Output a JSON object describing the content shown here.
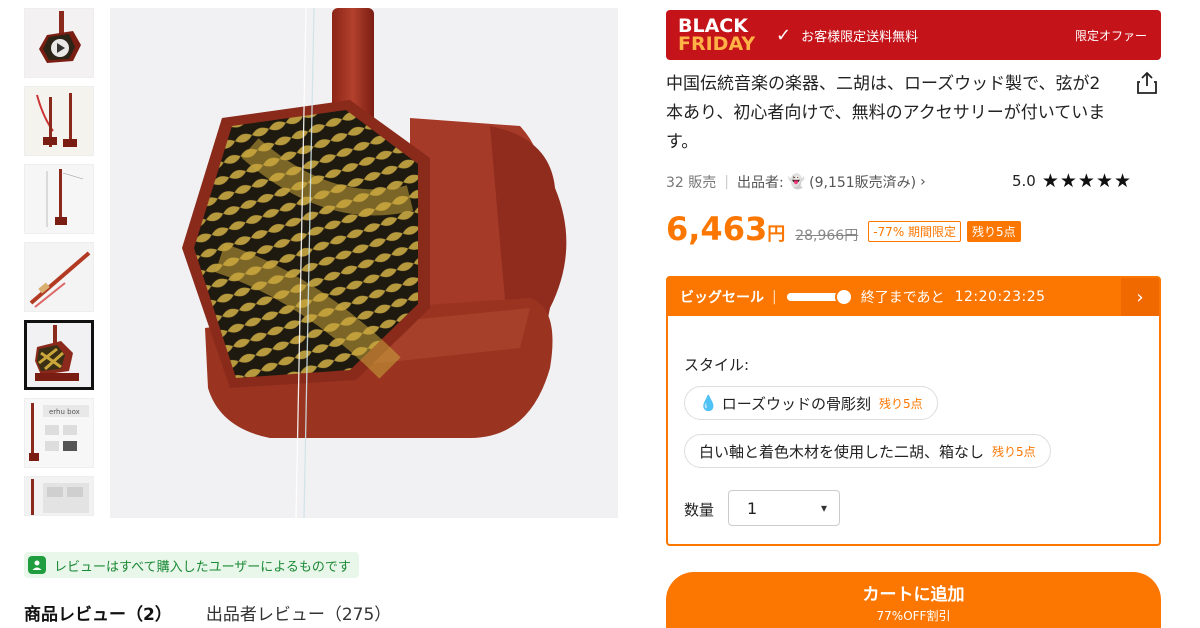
{
  "gallery": {
    "thumbnails": [
      "thumb-1",
      "thumb-2",
      "thumb-3",
      "thumb-4",
      "thumb-5",
      "thumb-6",
      "thumb-7"
    ],
    "thumb_box_text": "erhu box",
    "active_index": 4
  },
  "review_notice": {
    "text": "レビューはすべて購入したユーザーによるものです"
  },
  "tabs": {
    "product_reviews": "商品レビュー（2）",
    "seller_reviews": "出品者レビュー（275）"
  },
  "banner": {
    "logo_line1": "BLACK",
    "logo_line2": "FRIDAY",
    "free_shipping": "お客様限定送料無料",
    "offer": "限定オファー",
    "color": "#c5131a"
  },
  "product": {
    "title": "中国伝統音楽の楽器、二胡は、ローズウッド製で、弦が2本あり、初心者向けで、無料のアクセサリーが付いています。",
    "sold": "32 販売",
    "seller_label": "出品者:",
    "seller_sales": "(9,151販売済み)",
    "rating": "5.0",
    "stars": "★★★★★",
    "price": "6,463",
    "price_unit": "円",
    "original_price": "28,966円",
    "discount": "-77% 期間限定",
    "stock_left": "残り5点",
    "accent_color": "#fb7701"
  },
  "sale": {
    "title": "ビッグセール",
    "ends_label": "終了まであと",
    "countdown": "12:20:23:25",
    "style_label": "スタイル:",
    "options": [
      {
        "label": "ローズウッドの骨彫刻",
        "stock": "残り5点"
      },
      {
        "label": "白い軸と着色木材を使用した二胡、箱なし",
        "stock": "残り5点"
      }
    ],
    "qty_label": "数量",
    "qty_value": "1"
  },
  "cart": {
    "label": "カートに追加",
    "sub": "77%OFF割引"
  }
}
